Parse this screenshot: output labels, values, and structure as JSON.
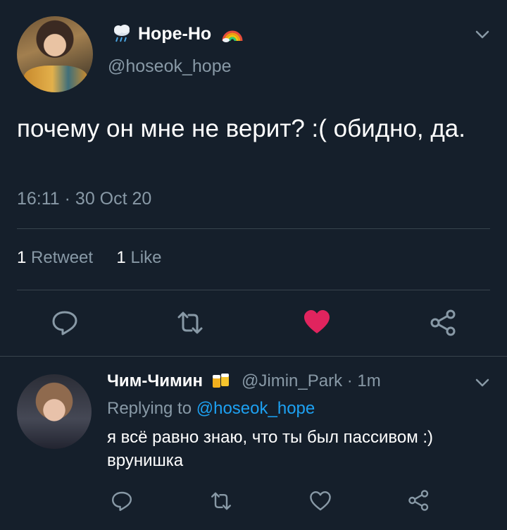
{
  "tweet": {
    "display_name": "Hope-Ho",
    "name_emoji_left": "cloud-with-rain-icon",
    "name_emoji_right": "rainbow-icon",
    "handle": "@hoseok_hope",
    "text": "почему он мне не верит? :( обидно, да.",
    "timestamp": "16:11 · 30 Oct 20",
    "retweet_count": "1",
    "retweet_label": "Retweet",
    "like_count": "1",
    "like_label": "Like",
    "liked": true
  },
  "reply": {
    "display_name": "Чим-Чимин",
    "name_emoji": "beer-mugs-icon",
    "handle_time": "@Jimin_Park · 1m",
    "replying_prefix": "Replying to",
    "replying_to": "@hoseok_hope",
    "text": "я всё равно знаю, что ты был пассивом :) врунишка"
  },
  "colors": {
    "background": "#151f2b",
    "muted": "#8899a6",
    "link": "#1da1f2",
    "like": "#e0245e",
    "divider": "#38444d"
  }
}
